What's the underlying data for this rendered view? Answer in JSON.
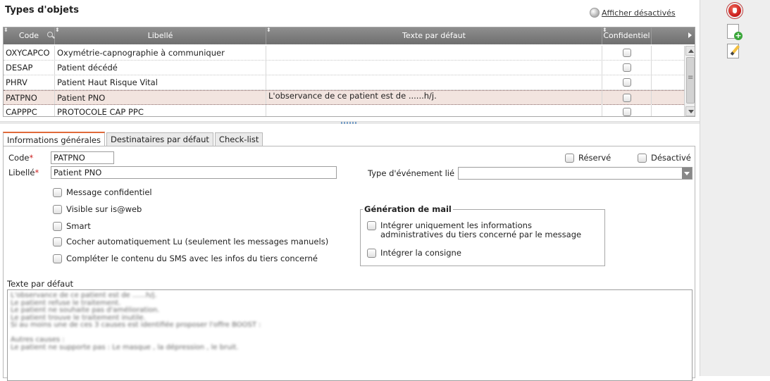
{
  "page": {
    "title": "Types d'objets",
    "show_inactive_link": "Afficher désactivés"
  },
  "grid": {
    "columns": [
      "Code",
      "Libellé",
      "Texte par défaut",
      "Confidentiel"
    ],
    "rows": [
      {
        "code": "OXYCAPCO",
        "label": "Oxymétrie-capnographie à communiquer",
        "default_text": ""
      },
      {
        "code": "DESAP",
        "label": "Patient décédé",
        "default_text": ""
      },
      {
        "code": "PHRV",
        "label": "Patient Haut Risque Vital",
        "default_text": ""
      },
      {
        "code": "PATPNO",
        "label": "Patient PNO",
        "default_text": "L'observance de ce patient est de   ......h/j."
      },
      {
        "code": "CAPPPC",
        "label": "PROTOCOLE CAP PPC",
        "default_text": ""
      }
    ],
    "selected_row": 3
  },
  "tabs": [
    "Informations générales",
    "Destinataires par défaut",
    "Check-list"
  ],
  "active_tab": 0,
  "form": {
    "code_label": "Code",
    "code_value": "PATPNO",
    "libelle_label": "Libellé",
    "libelle_value": "Patient PNO",
    "required_mark": "*",
    "reserve_label": "Réservé",
    "desactive_label": "Désactivé",
    "event_type_label": "Type d'événement lié",
    "event_type_value": "",
    "checkboxes": [
      "Message confidentiel",
      "Visible sur is@web",
      "Smart",
      "Cocher automatiquement Lu (seulement les messages manuels)",
      "Compléter le contenu du SMS avec les infos du tiers concerné"
    ],
    "mail_group": {
      "legend": "Génération de mail",
      "option1_line1": "Intégrer uniquement les informations",
      "option1_line2": "administratives du tiers concerné par le message",
      "option2": "Intégrer la consigne"
    },
    "default_text_label": "Texte par défaut",
    "default_text_lines": [
      "L'observance de ce patient est de  ......h/j.",
      "Le patient refuse le traitement.",
      "Le patient ne souhaite pas d'amélioration.",
      "Le patient trouve le traitement inutile.",
      "Si au moins une de ces 3 causes est identifiée proposer l'offre BOOST :",
      "",
      "Autres causes :",
      "Le patient ne supporte pas : Le masque , la dépression , le bruit."
    ]
  },
  "colors": {
    "header_bg": "#7f7f7f",
    "selected_row_bg": "#f2e4df",
    "active_tab_accent": "#e06a3a",
    "required": "#cc2222"
  },
  "icons": [
    "stop-hand-icon",
    "new-document-icon",
    "edit-document-icon"
  ]
}
